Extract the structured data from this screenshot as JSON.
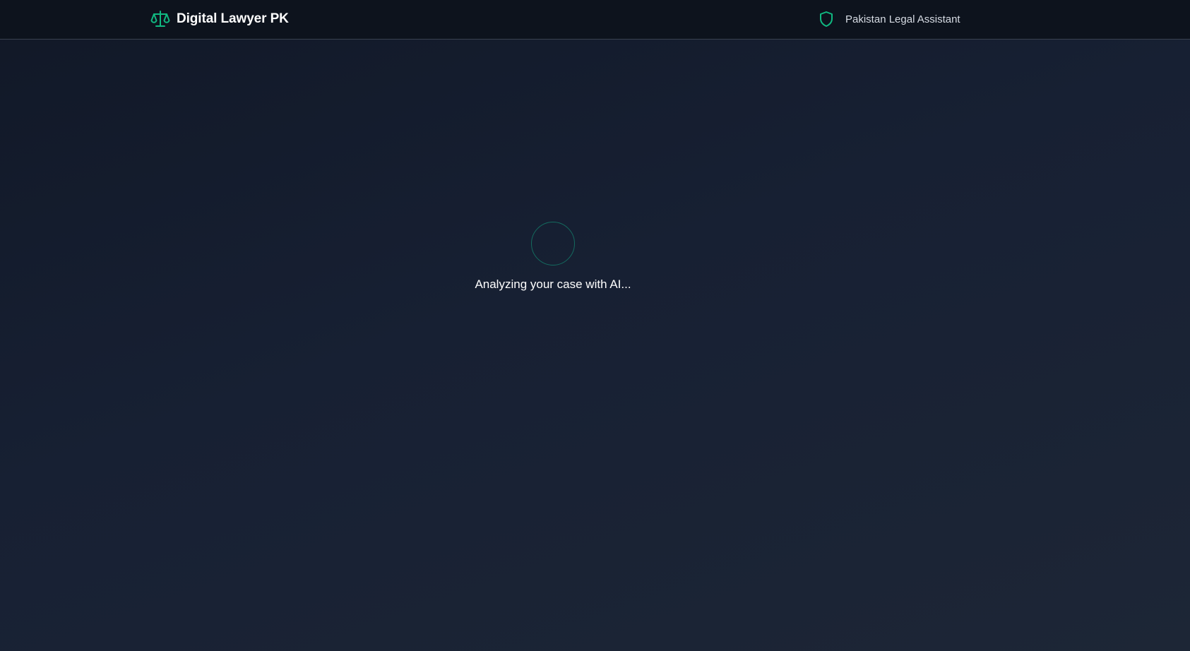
{
  "app": {
    "title": "Digital Lawyer PK",
    "logo_icon": "scales-of-justice-icon"
  },
  "header": {
    "assistant_label": "Pakistan Legal Assistant",
    "assistant_icon": "shield-icon"
  },
  "main": {
    "loading_text": "Analyzing your case with AI..."
  },
  "colors": {
    "accent": "#10b981",
    "background": "#111827",
    "header_background": "#0d131d",
    "spinner_ring": "#146b5f"
  }
}
